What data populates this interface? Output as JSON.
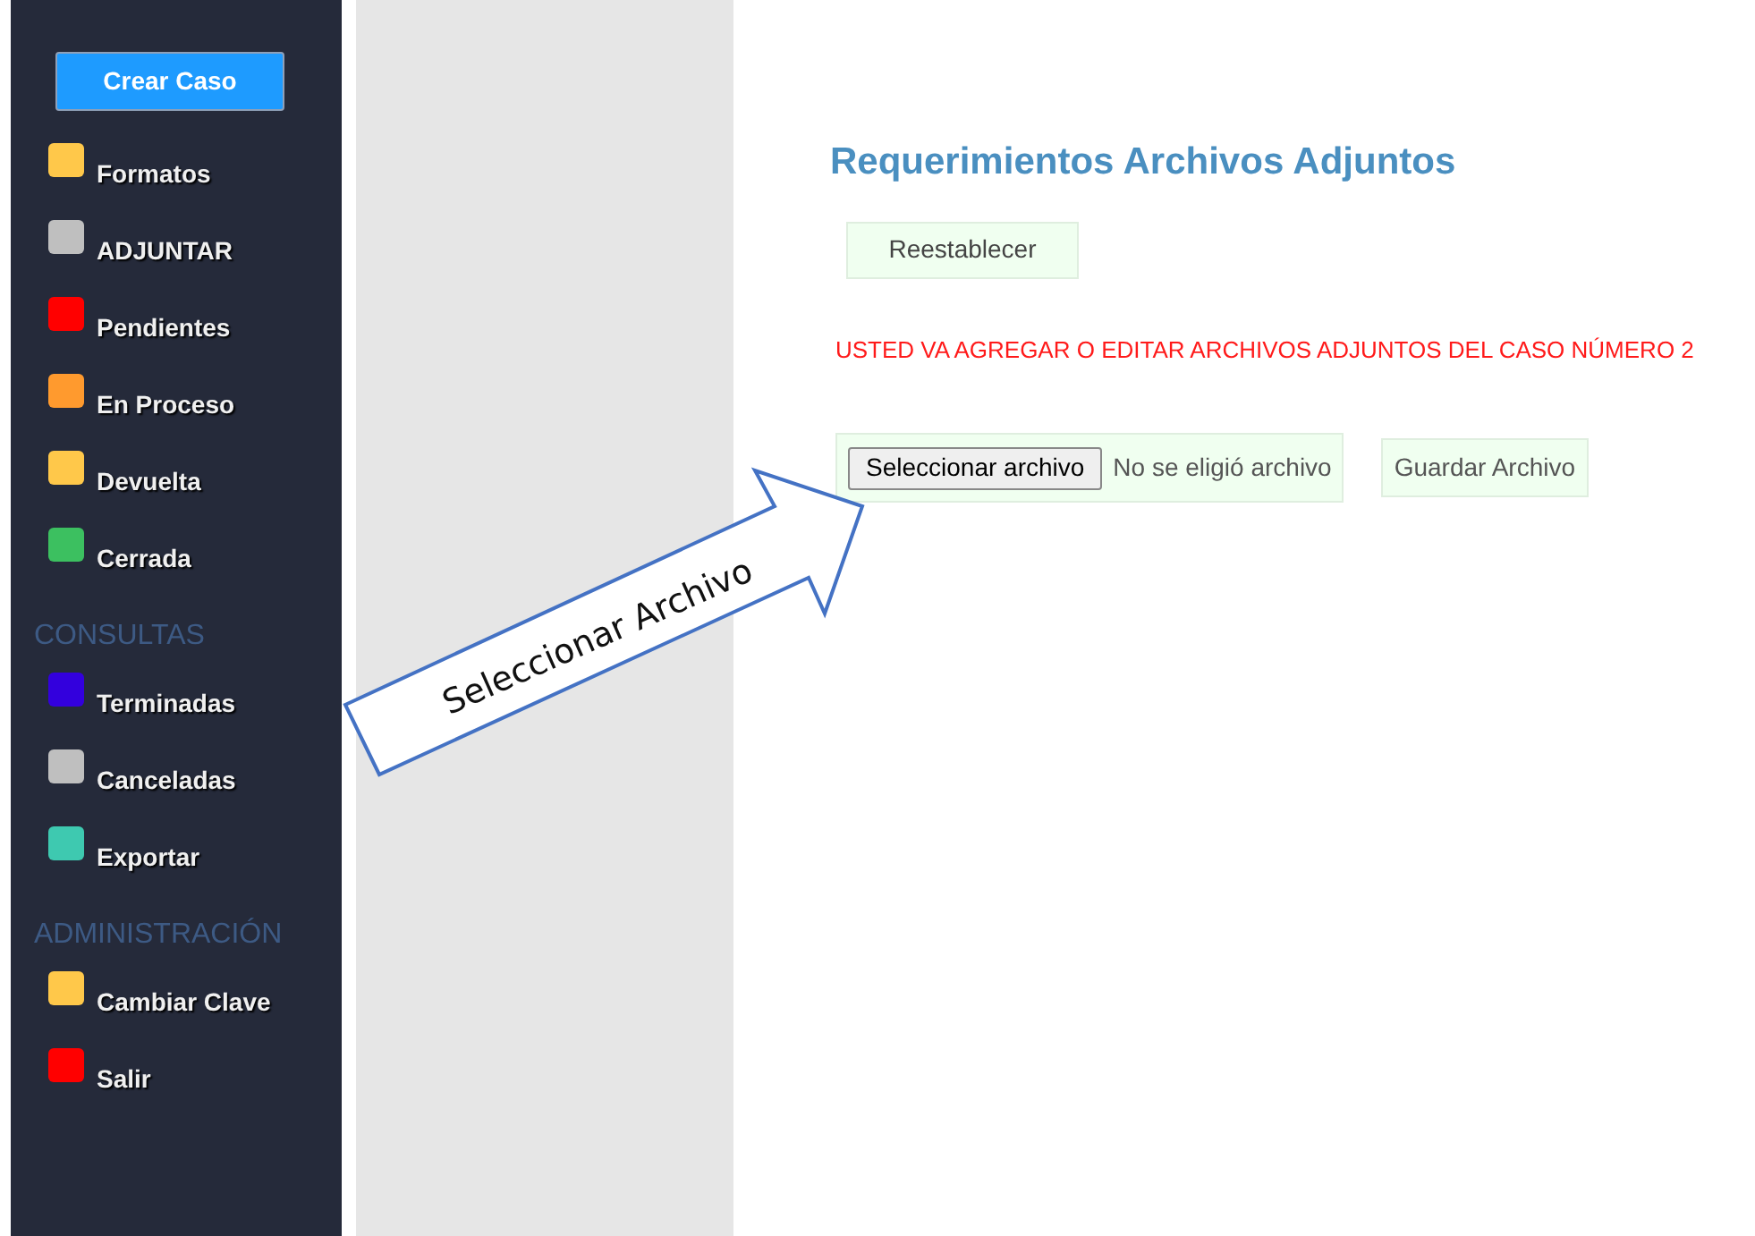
{
  "sidebar": {
    "create_button": "Crear Caso",
    "sections": [
      {
        "items": [
          {
            "label": "Formatos",
            "color": "#ffc84a"
          },
          {
            "label": "ADJUNTAR",
            "color": "#bfbfbf"
          },
          {
            "label": "Pendientes",
            "color": "#ff0000"
          },
          {
            "label": "En Proceso",
            "color": "#ff9a2e"
          },
          {
            "label": "Devuelta",
            "color": "#ffc84a"
          },
          {
            "label": "Cerrada",
            "color": "#3cc060"
          }
        ]
      },
      {
        "heading": "CONSULTAS",
        "items": [
          {
            "label": "Terminadas",
            "color": "#3300dd"
          },
          {
            "label": "Canceladas",
            "color": "#bfbfbf"
          },
          {
            "label": "Exportar",
            "color": "#3ec9b0"
          }
        ]
      },
      {
        "heading": "ADMINISTRACIÓN",
        "items": [
          {
            "label": "Cambiar Clave",
            "color": "#ffc84a"
          },
          {
            "label": "Salir",
            "color": "#ff0000"
          }
        ]
      }
    ]
  },
  "main": {
    "title": "Requerimientos Archivos Adjuntos",
    "reset_button": "Reestablecer",
    "notice": "USTED VA AGREGAR O EDITAR ARCHIVOS ADJUNTOS DEL CASO NÚMERO 2",
    "file_button": "Seleccionar archivo",
    "file_status": "No se eligió archivo",
    "save_button": "Guardar Archivo"
  },
  "callout": {
    "text": "Seleccionar Archivo"
  }
}
